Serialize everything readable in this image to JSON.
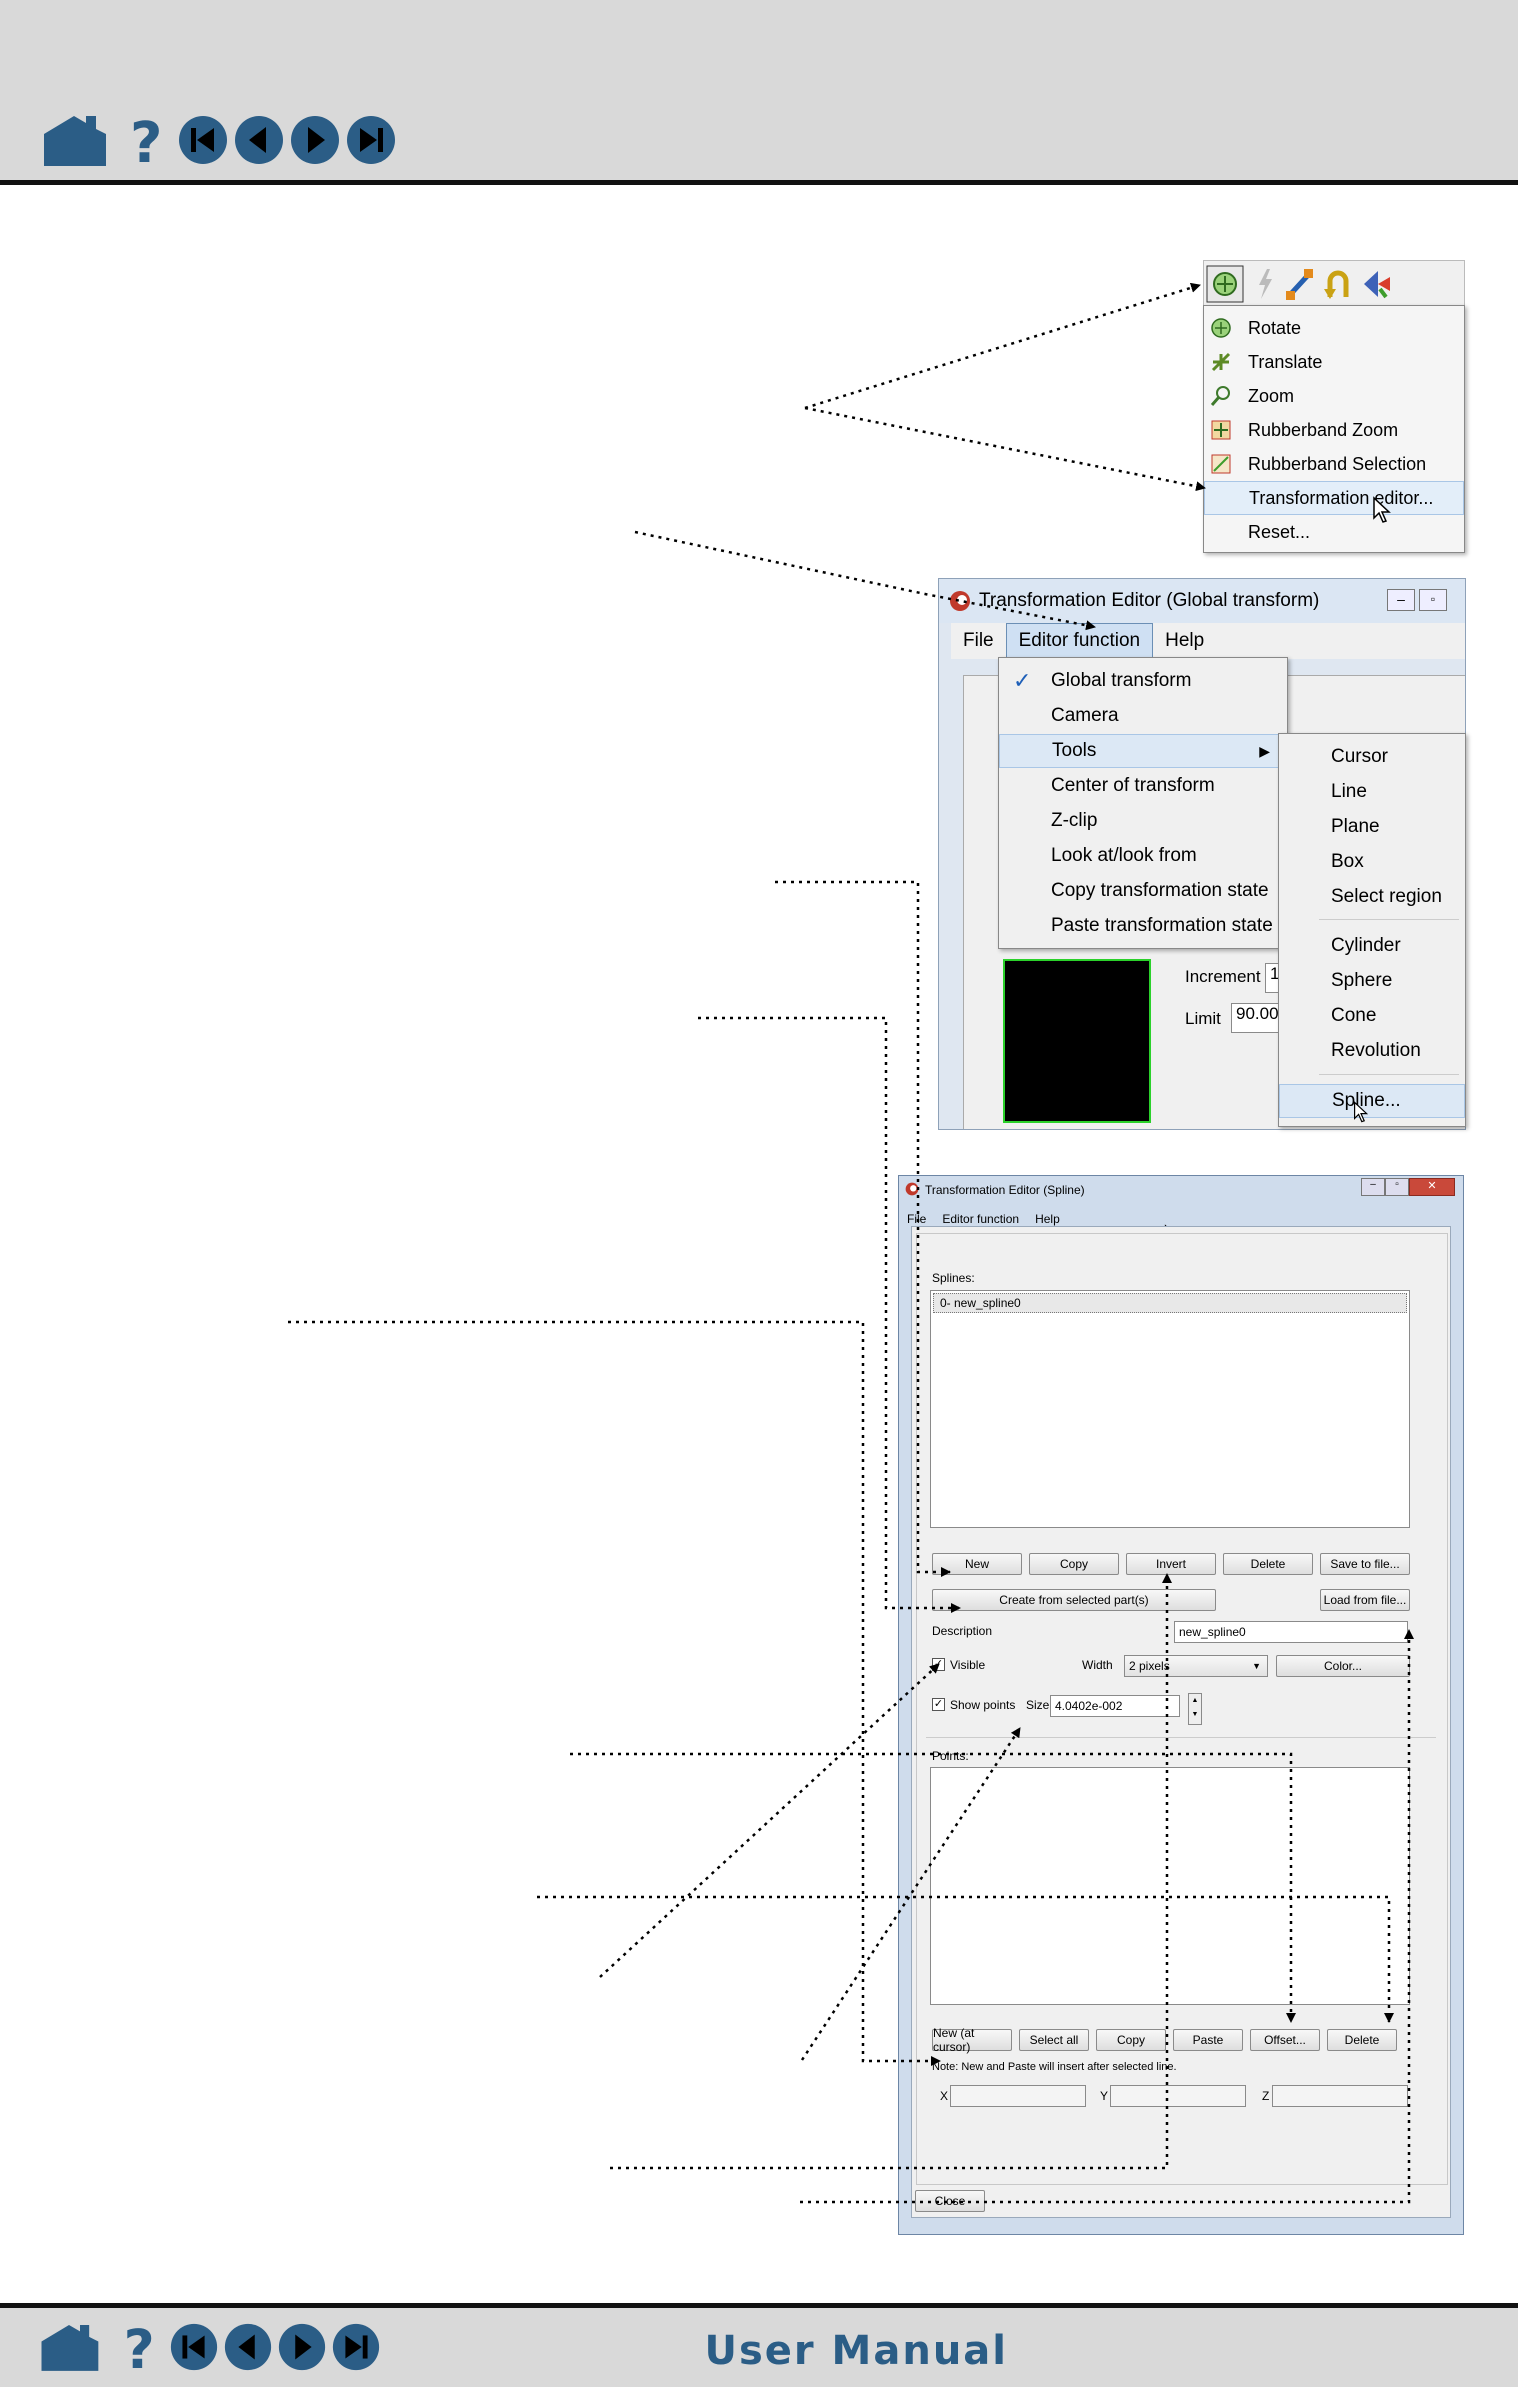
{
  "footer": {
    "title": "User Manual"
  },
  "nav_icons": [
    "home-icon",
    "help-icon",
    "first-page-icon",
    "previous-page-icon",
    "next-page-icon",
    "last-page-icon"
  ],
  "tool_menu": {
    "items": [
      "Rotate",
      "Translate",
      "Zoom",
      "Rubberband Zoom",
      "Rubberband Selection",
      "Transformation editor...",
      "Reset..."
    ],
    "highlighted": "Transformation editor..."
  },
  "global_editor": {
    "title": "Transformation Editor (Global transform)",
    "menu": [
      "File",
      "Editor function",
      "Help"
    ],
    "editor_function_items": [
      "Global transform",
      "Camera",
      "Tools",
      "Center of transform",
      "Z-clip",
      "Look at/look from",
      "Copy transformation state",
      "Paste transformation state"
    ],
    "checked": "Global transform",
    "tools_submenu": [
      "Cursor",
      "Line",
      "Plane",
      "Box",
      "Select region",
      "Cylinder",
      "Sphere",
      "Cone",
      "Revolution",
      "Spline..."
    ],
    "increment_label": "Increment",
    "increment_value": "1",
    "limit_label": "Limit",
    "limit_value": "90.000"
  },
  "spline_editor": {
    "title": "Transformation Editor (Spline)",
    "menu": [
      "File",
      "Editor function",
      "Help"
    ],
    "splines_label": "Splines:",
    "splines": [
      "0- new_spline0"
    ],
    "buttons_row1": [
      "New",
      "Copy",
      "Invert",
      "Delete",
      "Save to file..."
    ],
    "create_from_selected": "Create from selected part(s)",
    "load_from_file": "Load from file...",
    "description_label": "Description",
    "description_value": "new_spline0",
    "visible_label": "Visible",
    "width_label": "Width",
    "width_value": "2 pixels",
    "color_button": "Color...",
    "show_points_label": "Show points",
    "size_label": "Size",
    "size_value": "4.0402e-002",
    "points_label": "Points:",
    "buttons_row2": [
      "New (at cursor)",
      "Select all",
      "Copy",
      "Paste",
      "Offset...",
      "Delete"
    ],
    "note": "Note: New and Paste will insert after selected line.",
    "x_label": "X",
    "y_label": "Y",
    "z_label": "Z",
    "close_button": "Close"
  }
}
